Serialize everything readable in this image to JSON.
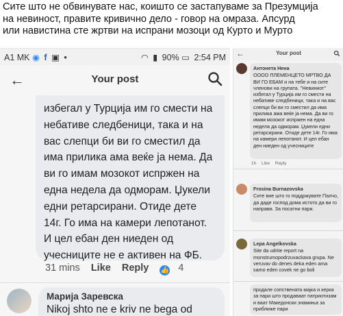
{
  "caption": {
    "lines": [
      "Сите што не обвинувате нас, коишто се застапуваме за Презумција",
      "на невиност, правите кривично дело - говор на омраза. Апсурд",
      "или навистина сте жртви на испрани мозоци од Курто и Мурто"
    ]
  },
  "main": {
    "status_left": "A1 MK",
    "status_time": "2:54 PM",
    "status_battery": "90%",
    "title": "Your post",
    "comment_text": "избегал у Турција им го смести на небативе следбеници, така и на вас слепци би ви го сместил да има прилика ама веќе ја нема. Да ви го имам мозокот испржен на една недела да одморам. Џукели едни ретарсирани. Отиде дете 14г. Го има на камери лепотанот. И цел ебан ден ниеден од учесниците не е активен на ФБ.",
    "time": "31 mins",
    "like": "Like",
    "reply": "Reply",
    "reaction_count": "4",
    "reply2_name": "Марија Заревска",
    "reply2_text": "Nikoj shto ne e kriv ne bega od"
  },
  "side": {
    "title": "Your post",
    "c1_name": "Антонета Нена",
    "c1_text": "ОООО ПЛЕМЕНЦЕТО МРТВО ДА ВИ ГО ЕБАМ и на тебе и на сите членови на групата. \"Невиниот\" избегал у Турција им го смести на небативе следбеници, така и на вас слепци би ви го сместил да има прилика ама веќе ја нема. Да ви го имам мозокот испржен на една недела да одморам. Џукели едни ретарсирани. Отиде дете 14г. Го има на камери лепотанот. И цел ебан ден ниеден од учесниците",
    "c2_name": "Frosina Burnazovska",
    "c2_text": "Сите вие што го поддржувате Палчо, да даде господ дома истото да ви го направи. За посатни пари.",
    "c3_name": "Lepa Angelkovska",
    "c3_text": "Site da udrite report na monstrumopodrzuvackava grupa. Ne veruvav do denes deka eden ama samo eden covek ne go boli",
    "c4_text": "продале сопствената мајка и керка за пари што продаваат патриотизам и ваат Македонски знамиња за приближе пари",
    "act_time": "1h",
    "act_like": "Like",
    "act_reply": "Reply"
  }
}
